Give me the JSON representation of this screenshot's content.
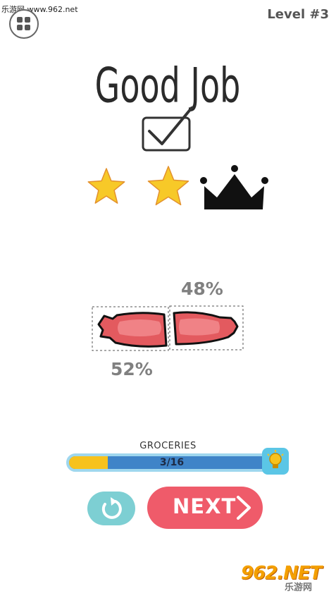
{
  "watermark_top": "乐游网 www.962.net",
  "header": {
    "menu_icon": "grid-icon",
    "level_label": "Level #3"
  },
  "result": {
    "title": "Good Job",
    "check_icon": "checkbox-checked-icon",
    "stars_earned": 2,
    "stars_total": 2,
    "crown_earned": false,
    "colors": {
      "star": "#f7c928",
      "star_outline": "#e3912d",
      "crown": "#111111"
    }
  },
  "cut": {
    "object_icon": "sausage-icon",
    "left_piece_pct": "52%",
    "right_piece_pct": "48%",
    "colors": {
      "sausage": "#e35a5f",
      "sausage_highlight": "#f28a8d",
      "outline": "#111111"
    }
  },
  "progress": {
    "category_label": "GROCERIES",
    "text": "3/16",
    "current": 3,
    "total": 16,
    "hint_icon": "lightbulb-icon",
    "colors": {
      "track": "#3f84c8",
      "fill": "#f7c21d",
      "border": "#9fd7ee",
      "hint_bg": "#5bc6e6"
    }
  },
  "buttons": {
    "restart_icon": "restart-icon",
    "next_label": "NEXT",
    "next_icon": "chevron-right-icon",
    "colors": {
      "restart": "#7dcfd3",
      "next": "#ef5b6a"
    }
  },
  "watermark_logo": {
    "main": "962.NET",
    "sub": "乐游网"
  }
}
